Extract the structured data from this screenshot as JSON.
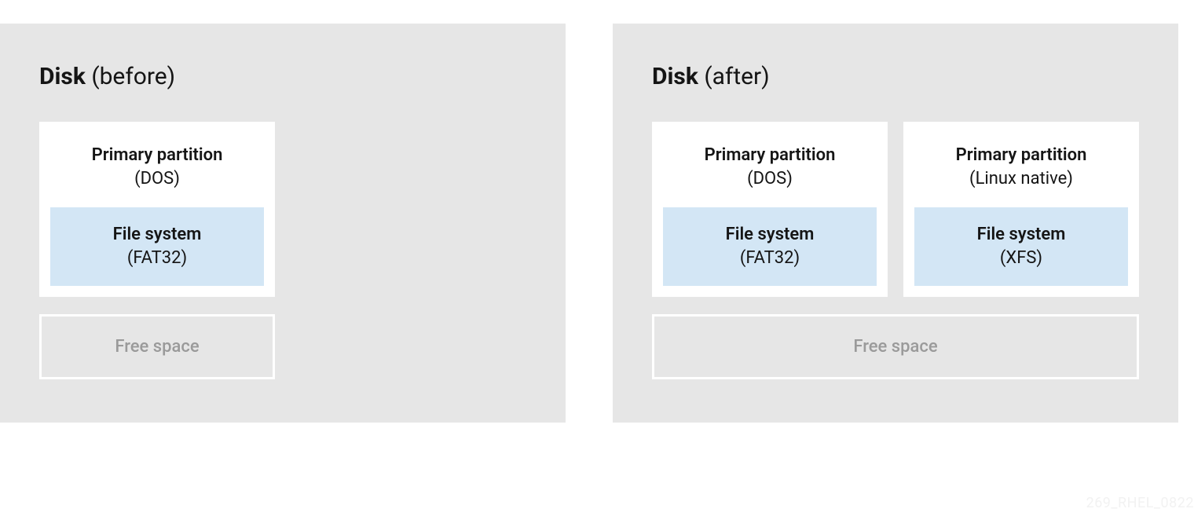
{
  "before": {
    "title_strong": "Disk",
    "title_suffix": " (before)",
    "partitions": [
      {
        "title": "Primary partition",
        "subtitle": "(DOS)",
        "fs_title": "File system",
        "fs_subtitle": "(FAT32)"
      }
    ],
    "free_space_label": "Free space"
  },
  "after": {
    "title_strong": "Disk",
    "title_suffix": " (after)",
    "partitions": [
      {
        "title": "Primary partition",
        "subtitle": "(DOS)",
        "fs_title": "File system",
        "fs_subtitle": "(FAT32)"
      },
      {
        "title": "Primary partition",
        "subtitle": "(Linux native)",
        "fs_title": "File system",
        "fs_subtitle": "(XFS)"
      }
    ],
    "free_space_label": "Free space"
  },
  "watermark": "269_RHEL_0822"
}
